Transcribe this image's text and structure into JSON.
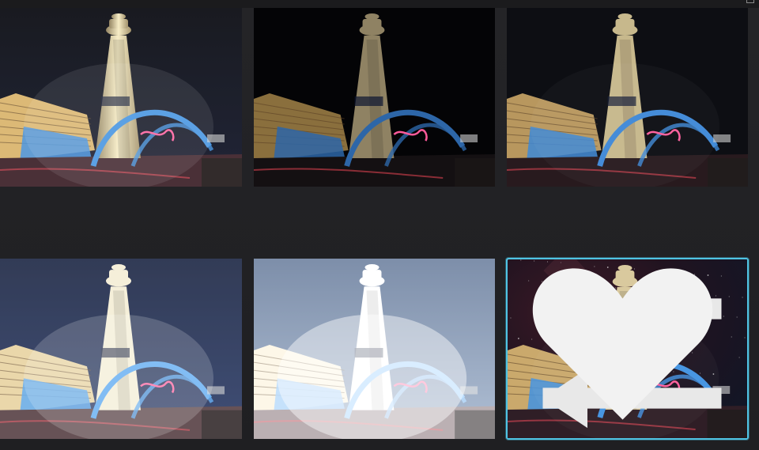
{
  "window": {
    "corner_icon": "panel-icon"
  },
  "gallery": {
    "layout": "3-column grid",
    "tiles": [
      {
        "variant": "original",
        "selected": false
      },
      {
        "variant": "dark",
        "selected": false
      },
      {
        "variant": "balanced",
        "selected": false
      },
      {
        "variant": "bright",
        "selected": false
      },
      {
        "variant": "overexposed",
        "selected": false
      },
      {
        "variant": "night-sky-enhanced",
        "selected": true,
        "icons": [
          "adjustments-icon",
          "heart-icon"
        ]
      }
    ]
  },
  "colors": {
    "background": "#202023",
    "selection_border": "#4fc3e3",
    "arch_blue": "#3d8fe0",
    "neon_pink": "#ff5a9a"
  }
}
